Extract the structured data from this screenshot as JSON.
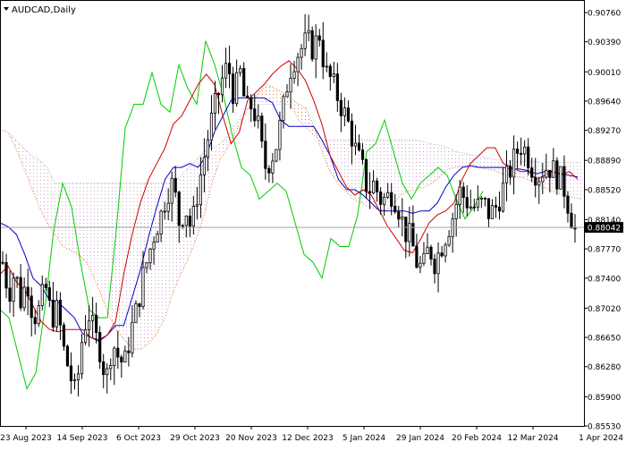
{
  "window": {
    "symbol_label": "AUDCAD,Daily"
  },
  "chart_data": {
    "type": "candlestick",
    "title": "AUDCAD,Daily",
    "y_axis": {
      "ticks": [
        "0.90760",
        "0.90390",
        "0.90010",
        "0.89640",
        "0.89270",
        "0.88890",
        "0.88520",
        "0.88140",
        "0.87770",
        "0.87400",
        "0.87020",
        "0.86650",
        "0.86280",
        "0.85900",
        "0.85530"
      ],
      "range": [
        0.8553,
        0.9076
      ]
    },
    "x_axis": {
      "ticks": [
        "23 Aug 2023",
        "14 Sep 2023",
        "6 Oct 2023",
        "29 Oct 2023",
        "20 Nov 2023",
        "12 Dec 2023",
        "5 Jan 2024",
        "29 Jan 2024",
        "20 Feb 2024",
        "12 Mar 2024",
        "1 Apr 2024"
      ]
    },
    "current_price": {
      "value": 0.88042,
      "label": "0.88042"
    },
    "colors": {
      "candles": "#000000",
      "tenkan_sen": "#cc0000",
      "kijun_sen": "#0000cc",
      "chikou_span": "#00cc00",
      "senkou_span_a": "#e07830",
      "senkou_span_b": "#c8a2c8",
      "price_line": "#a0a0a0"
    },
    "ichimoku": {
      "tenkan_sen": [
        0.8745,
        0.8755,
        0.8735,
        0.8725,
        0.8705,
        0.8685,
        0.8675,
        0.8672,
        0.8675,
        0.8675,
        0.8675,
        0.8665,
        0.8662,
        0.8668,
        0.8685,
        0.8745,
        0.8795,
        0.8835,
        0.8865,
        0.8885,
        0.8905,
        0.8935,
        0.8945,
        0.8965,
        0.8985,
        0.8998,
        0.8985,
        0.8945,
        0.891,
        0.8925,
        0.8965,
        0.8975,
        0.8985,
        0.8998,
        0.9008,
        0.9015,
        0.9005,
        0.899,
        0.8965,
        0.8935,
        0.8895,
        0.8875,
        0.8855,
        0.8845,
        0.8852,
        0.8845,
        0.8825,
        0.8805,
        0.879,
        0.8775,
        0.8772,
        0.879,
        0.881,
        0.882,
        0.8825,
        0.8835,
        0.8865,
        0.8885,
        0.8895,
        0.8905,
        0.8905,
        0.8885,
        0.888,
        0.8875,
        0.8875,
        0.8865,
        0.887,
        0.8875,
        0.887,
        0.8875,
        0.8865
      ],
      "kijun_sen": [
        0.881,
        0.8805,
        0.8795,
        0.877,
        0.874,
        0.873,
        0.8712,
        0.871,
        0.87,
        0.869,
        0.867,
        0.8665,
        0.866,
        0.8668,
        0.868,
        0.868,
        0.8715,
        0.875,
        0.8792,
        0.883,
        0.8865,
        0.888,
        0.888,
        0.8885,
        0.888,
        0.8895,
        0.8925,
        0.8945,
        0.8965,
        0.8968,
        0.8968,
        0.8968,
        0.8968,
        0.8962,
        0.894,
        0.8932,
        0.8932,
        0.8932,
        0.8932,
        0.8915,
        0.8895,
        0.8865,
        0.8852,
        0.8852,
        0.8845,
        0.8835,
        0.8825,
        0.8825,
        0.8825,
        0.8825,
        0.8822,
        0.8825,
        0.8825,
        0.8835,
        0.8855,
        0.887,
        0.888,
        0.8882,
        0.888,
        0.888,
        0.888,
        0.888,
        0.8878,
        0.8878,
        0.8876,
        0.8872,
        0.8875,
        0.8875,
        0.8872,
        0.887,
        0.8868
      ],
      "chikou_span": [
        0.87,
        0.869,
        0.8645,
        0.86,
        0.862,
        0.87,
        0.88,
        0.886,
        0.883,
        0.876,
        0.87,
        0.869,
        0.869,
        0.88,
        0.893,
        0.896,
        0.896,
        0.9,
        0.896,
        0.895,
        0.901,
        0.898,
        0.896,
        0.904,
        0.901,
        0.897,
        0.892,
        0.888,
        0.887,
        0.884,
        0.885,
        0.886,
        0.885,
        0.881,
        0.877,
        0.876,
        0.874,
        0.879,
        0.878,
        0.878,
        0.882,
        0.89,
        0.891,
        0.894,
        0.89,
        0.886,
        0.884,
        0.886,
        0.887,
        0.888,
        0.887,
        0.884,
        0.8815,
        0.883,
        0.885
      ],
      "senkou_span_a": [
        0.8928,
        0.8925,
        0.8905,
        0.888,
        0.8855,
        0.883,
        0.881,
        0.8795,
        0.878,
        0.8775,
        0.877,
        0.876,
        0.874,
        0.8715,
        0.869,
        0.8672,
        0.866,
        0.865,
        0.865,
        0.8658,
        0.867,
        0.869,
        0.872,
        0.8745,
        0.8765,
        0.879,
        0.882,
        0.886,
        0.889,
        0.8905,
        0.8925,
        0.8945,
        0.896,
        0.8975,
        0.8985,
        0.898,
        0.8975,
        0.8968,
        0.896,
        0.8955,
        0.893,
        0.89,
        0.8875,
        0.886,
        0.885,
        0.884,
        0.8835,
        0.883,
        0.8828,
        0.8825,
        0.8832,
        0.8845,
        0.885,
        0.8852,
        0.8855,
        0.886,
        0.8868,
        0.8878,
        0.888,
        0.8882,
        0.8884,
        0.888,
        0.8878,
        0.8876,
        0.8872,
        0.887,
        0.8868,
        0.8866,
        0.886,
        0.8855,
        0.8852,
        0.8848,
        0.8845,
        0.8842,
        0.884
      ],
      "senkou_span_b": [
        0.8928,
        0.8925,
        0.8915,
        0.8905,
        0.8895,
        0.889,
        0.888,
        0.886,
        0.886,
        0.886,
        0.886,
        0.886,
        0.886,
        0.886,
        0.886,
        0.886,
        0.886,
        0.886,
        0.886,
        0.886,
        0.886,
        0.886,
        0.886,
        0.8868,
        0.888,
        0.889,
        0.89,
        0.8905,
        0.891,
        0.892,
        0.8935,
        0.895,
        0.896,
        0.896,
        0.896,
        0.896,
        0.896,
        0.896,
        0.894,
        0.893,
        0.892,
        0.8915,
        0.8915,
        0.8915,
        0.8915,
        0.8915,
        0.8915,
        0.8915,
        0.8915,
        0.8915,
        0.8915,
        0.8915,
        0.8915,
        0.8915,
        0.8912,
        0.891,
        0.8908,
        0.8905,
        0.89,
        0.8898,
        0.8896,
        0.8894,
        0.8892,
        0.889,
        0.889,
        0.8888,
        0.8888,
        0.8888,
        0.8888,
        0.8886,
        0.8886,
        0.8886,
        0.8886,
        0.8886,
        0.8886
      ]
    },
    "price_path": [
      0.876,
      0.872,
      0.875,
      0.871,
      0.874,
      0.869,
      0.87,
      0.873,
      0.869,
      0.87,
      0.865,
      0.862,
      0.859,
      0.866,
      0.87,
      0.867,
      0.865,
      0.861,
      0.866,
      0.864,
      0.863,
      0.867,
      0.87,
      0.874,
      0.877,
      0.88,
      0.882,
      0.885,
      0.886,
      0.881,
      0.883,
      0.88,
      0.885,
      0.889,
      0.893,
      0.896,
      0.899,
      0.901,
      0.897,
      0.9,
      0.895,
      0.896,
      0.893,
      0.888,
      0.889,
      0.891,
      0.895,
      0.9,
      0.902,
      0.903,
      0.904,
      0.903,
      0.905,
      0.9,
      0.899,
      0.897,
      0.895,
      0.893,
      0.89,
      0.888,
      0.885,
      0.886,
      0.884,
      0.884,
      0.885,
      0.883,
      0.88,
      0.879,
      0.876,
      0.875,
      0.878,
      0.876,
      0.878,
      0.88,
      0.882,
      0.885,
      0.884,
      0.883,
      0.883,
      0.8835,
      0.882,
      0.883,
      0.885,
      0.887,
      0.889,
      0.891,
      0.89,
      0.888,
      0.887,
      0.888,
      0.888,
      0.887,
      0.886,
      0.883,
      0.88
    ]
  }
}
